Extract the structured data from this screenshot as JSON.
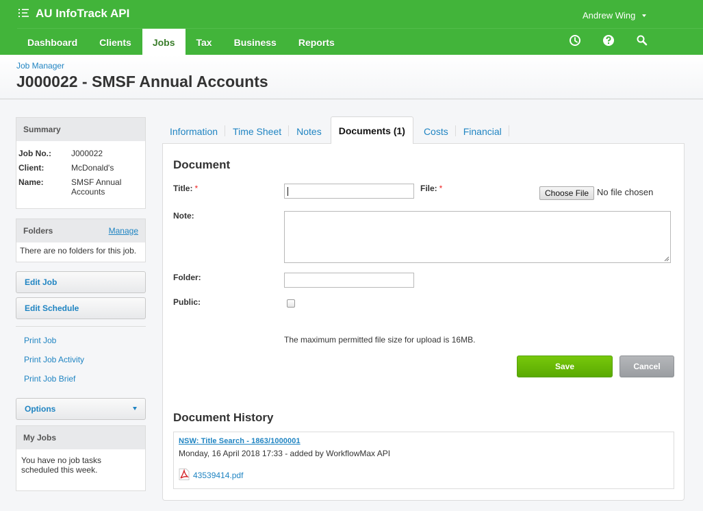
{
  "app": {
    "title": "AU InfoTrack API",
    "menu_icon": "list-icon",
    "user_name": "Andrew Wing"
  },
  "nav": {
    "items": [
      {
        "label": "Dashboard",
        "active": false
      },
      {
        "label": "Clients",
        "active": false
      },
      {
        "label": "Jobs",
        "active": true
      },
      {
        "label": "Tax",
        "active": false
      },
      {
        "label": "Business",
        "active": false
      },
      {
        "label": "Reports",
        "active": false
      }
    ],
    "icons": [
      "clock-icon",
      "help-icon",
      "search-icon"
    ]
  },
  "header": {
    "breadcrumb": "Job Manager",
    "title": "J000022 - SMSF Annual Accounts"
  },
  "sidebar": {
    "summary": {
      "heading": "Summary",
      "rows": [
        {
          "key": "Job No.:",
          "value": "J000022"
        },
        {
          "key": "Client:",
          "value": "McDonald's"
        },
        {
          "key": "Name:",
          "value": "SMSF Annual Accounts"
        }
      ]
    },
    "folders": {
      "heading": "Folders",
      "manage_label": "Manage",
      "empty_text": "There are no folders for this job."
    },
    "buttons": {
      "edit_job": "Edit Job",
      "edit_schedule": "Edit Schedule"
    },
    "print_links": [
      "Print Job",
      "Print Job Activity",
      "Print Job Brief"
    ],
    "options_label": "Options",
    "my_jobs": {
      "heading": "My Jobs",
      "text": "You have no job tasks scheduled this week."
    }
  },
  "tabs": [
    {
      "label": "Information",
      "active": false
    },
    {
      "label": "Time Sheet",
      "active": false
    },
    {
      "label": "Notes",
      "active": false
    },
    {
      "label": "Documents (1)",
      "active": true
    },
    {
      "label": "Costs",
      "active": false
    },
    {
      "label": "Financial",
      "active": false
    }
  ],
  "form": {
    "heading": "Document",
    "title_label": "Title:",
    "title_value": "",
    "file_label": "File:",
    "required_mark": "*",
    "choose_file_label": "Choose File",
    "no_file_text": "No file chosen",
    "note_label": "Note:",
    "note_value": "",
    "folder_label": "Folder:",
    "folder_value": "",
    "public_label": "Public:",
    "public_checked": false,
    "hint": "The maximum permitted file size for upload is 16MB.",
    "save_label": "Save",
    "cancel_label": "Cancel"
  },
  "history": {
    "heading": "Document History",
    "items": [
      {
        "title": "NSW: Title Search - 1863/1000001",
        "meta": "Monday, 16 April 2018 17:33 - added by WorkflowMax API",
        "file_icon": "pdf-icon",
        "file_name": "43539414.pdf"
      }
    ]
  },
  "colors": {
    "brand_green": "#42b43a",
    "link_blue": "#1f84c2",
    "save_green": "#6bbd06",
    "cancel_gray": "#a6a9ad",
    "required_red": "#e22222"
  }
}
